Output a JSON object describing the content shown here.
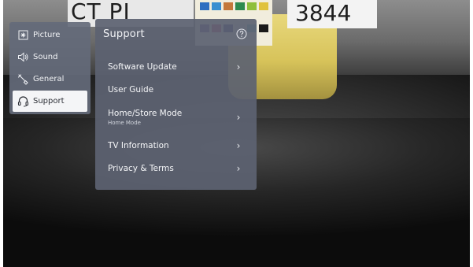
{
  "background_scene": {
    "letters_left": "CT PI",
    "number_right": "3844",
    "swatch_colors": [
      "#2f6fc0",
      "#3a8fd0",
      "#c4783a",
      "#2d8a4e",
      "#8fbf3a",
      "#e0c23d",
      "#6a4ea0",
      "#c43f6c",
      "#2a2a7a",
      "#d8d8d8",
      "#5fb0c9",
      "#1a1a1a"
    ]
  },
  "category_menu": {
    "items": [
      {
        "label": "Picture",
        "icon": "picture-icon",
        "active": false
      },
      {
        "label": "Sound",
        "icon": "speaker-icon",
        "active": false
      },
      {
        "label": "General",
        "icon": "wrench-icon",
        "active": false
      },
      {
        "label": "Support",
        "icon": "headset-icon",
        "active": true
      }
    ]
  },
  "support_panel": {
    "title": "Support",
    "help_icon": "help-icon",
    "items": [
      {
        "label": "Software Update",
        "sub": "",
        "has_chevron": true
      },
      {
        "label": "User Guide",
        "sub": "",
        "has_chevron": false
      },
      {
        "label": "Home/Store Mode",
        "sub": "Home Mode",
        "has_chevron": true
      },
      {
        "label": "TV Information",
        "sub": "",
        "has_chevron": true
      },
      {
        "label": "Privacy & Terms",
        "sub": "",
        "has_chevron": true
      }
    ]
  },
  "colors": {
    "panel_bg": "#5c6271",
    "active_item_bg": "#f4f5f7",
    "text": "#f3f4f7"
  }
}
